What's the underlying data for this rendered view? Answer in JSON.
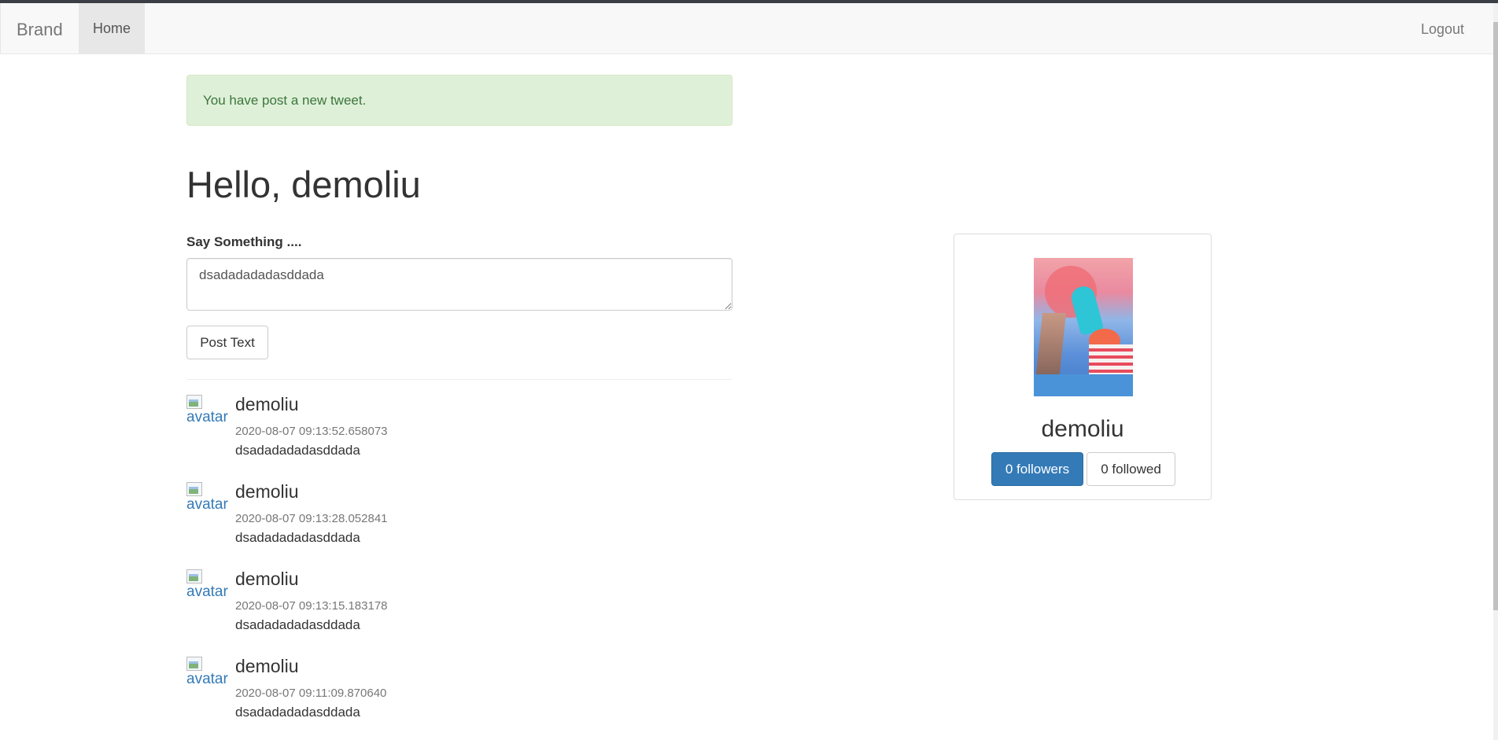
{
  "navbar": {
    "brand": "Brand",
    "home": "Home",
    "logout": "Logout"
  },
  "alert": {
    "message": "You have post a new tweet."
  },
  "greeting": "Hello, demoliu",
  "composer": {
    "label": "Say Something ....",
    "value": "dsadadadadasddada",
    "submit_label": "Post Text"
  },
  "tweets": [
    {
      "avatar_alt": "avatar",
      "author": "demoliu",
      "timestamp": "2020-08-07 09:13:52.658073",
      "body": "dsadadadadasddada"
    },
    {
      "avatar_alt": "avatar",
      "author": "demoliu",
      "timestamp": "2020-08-07 09:13:28.052841",
      "body": "dsadadadadasddada"
    },
    {
      "avatar_alt": "avatar",
      "author": "demoliu",
      "timestamp": "2020-08-07 09:13:15.183178",
      "body": "dsadadadadasddada"
    },
    {
      "avatar_alt": "avatar",
      "author": "demoliu",
      "timestamp": "2020-08-07 09:11:09.870640",
      "body": "dsadadadadasddada"
    }
  ],
  "profile": {
    "name": "demoliu",
    "followers_label": "0 followers",
    "followed_label": "0 followed"
  },
  "colors": {
    "primary": "#337ab7",
    "alert_bg": "#dff0d8",
    "alert_text": "#3c763d",
    "navbar_bg": "#f8f8f8"
  }
}
